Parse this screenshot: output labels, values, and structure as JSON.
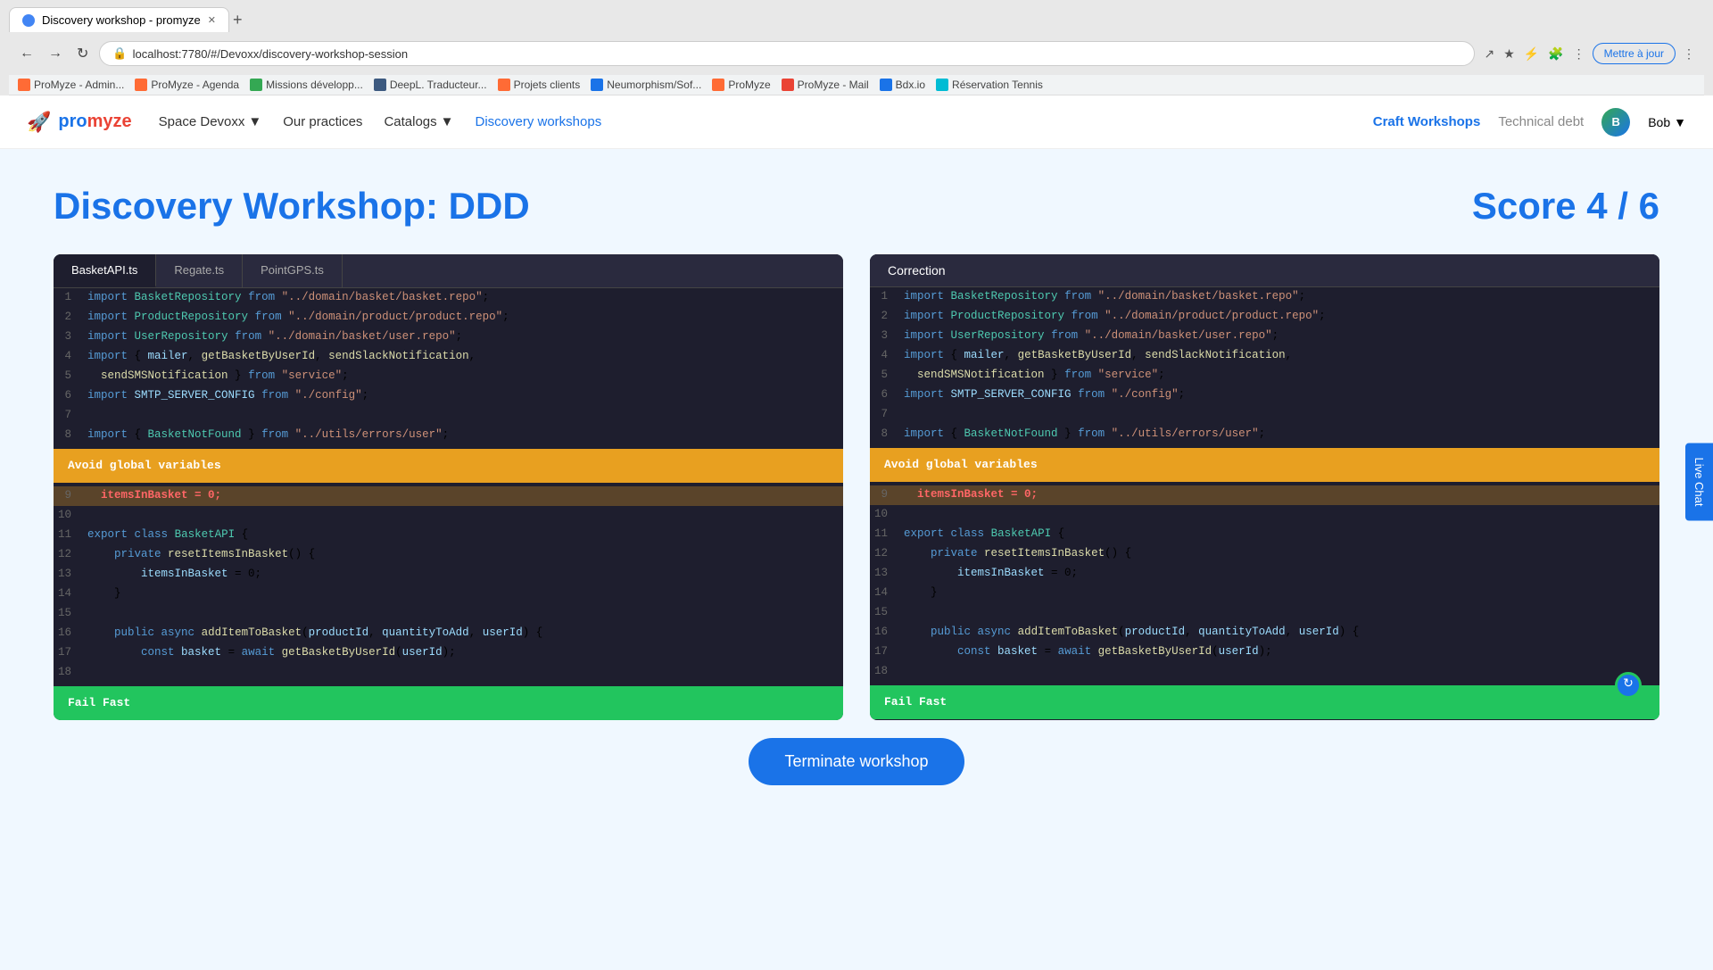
{
  "browser": {
    "tab_title": "Discovery workshop - promyze",
    "url": "localhost:7780/#/Devoxx/discovery-workshop-session",
    "update_btn": "Mettre à jour",
    "new_tab": "+"
  },
  "bookmarks": [
    {
      "label": "ProMyze - Admin...",
      "type": "p"
    },
    {
      "label": "ProMyze - Agenda",
      "type": "p"
    },
    {
      "label": "Missions développ...",
      "type": "a"
    },
    {
      "label": "DeepL. Traducteur...",
      "type": "d"
    },
    {
      "label": "Projets clients",
      "type": "pr"
    },
    {
      "label": "Neumorphism/Sof...",
      "type": "b"
    },
    {
      "label": "ProMyze",
      "type": "p"
    },
    {
      "label": "ProMyze - Mail",
      "type": "mail"
    },
    {
      "label": "Bdx.io",
      "type": "b"
    },
    {
      "label": "Réservation Tennis",
      "type": "r"
    }
  ],
  "nav": {
    "logo": "promyze",
    "space": "Space Devoxx",
    "our_practices": "Our practices",
    "catalogs": "Catalogs",
    "discovery_workshops": "Discovery workshops",
    "craft_workshops": "Craft Workshops",
    "technical_debt": "Technical debt",
    "user": "Bob"
  },
  "page": {
    "title": "Discovery Workshop: DDD",
    "score": "Score 4 / 6"
  },
  "left_panel": {
    "tabs": [
      "BasketAPI.ts",
      "Regate.ts",
      "PointGPS.ts"
    ],
    "active_tab": "BasketAPI.ts",
    "warning_label": "Avoid global variables",
    "success_label": "Fail Fast"
  },
  "right_panel": {
    "tab": "Correction",
    "warning_label": "Avoid global variables",
    "success_label": "Fail Fast"
  },
  "terminate_btn": "Terminate workshop",
  "live_chat": "Live Chat",
  "code_lines": [
    "import BasketRepository from \"../domain/basket/basket.repo\";",
    "import ProductRepository from \"../domain/product/product.repo\";",
    "import UserRepository from \"../domain/basket/user.repo\";",
    "import { mailer, getBasketByUserId, sendSlackNotification,",
    "  sendSMSNotification } from \"service\";",
    "import SMTP_SERVER_CONFIG from \"./config\";",
    "",
    "import { BasketNotFound } from \"../utils/errors/user\";",
    "",
    "  itemsInBasket = 0;",
    "",
    "export class BasketAPI {",
    "    private resetItemsInBasket() {",
    "        itemsInBasket = 0;",
    "    }",
    "",
    "    public async addItemToBasket(productId, quantityToAdd, userId) {",
    "        const basket = await getBasketByUserId(userId);",
    ""
  ]
}
